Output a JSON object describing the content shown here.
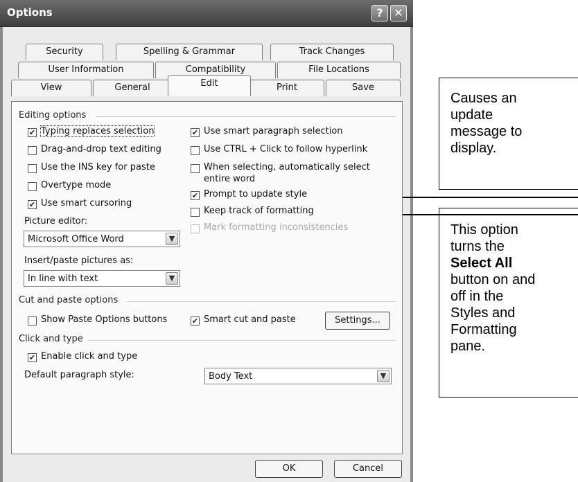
{
  "dialog": {
    "title": "Options",
    "help_symbol": "?",
    "close_symbol": "✕"
  },
  "tabs": {
    "row1": [
      "Security",
      "Spelling & Grammar",
      "Track Changes"
    ],
    "row2": [
      "User Information",
      "Compatibility",
      "File Locations"
    ],
    "row3": [
      "View",
      "General",
      "Edit",
      "Print",
      "Save"
    ],
    "active": "Edit"
  },
  "editing": {
    "section": "Editing options",
    "typing_replaces": "Typing replaces selection",
    "drag_drop": "Drag-and-drop text editing",
    "ins_key": "Use the INS key for paste",
    "overtype": "Overtype mode",
    "smart_cursoring": "Use smart cursoring",
    "picture_editor_label": "Picture editor:",
    "picture_editor_value": "Microsoft Office Word",
    "insert_paste_label": "Insert/paste pictures as:",
    "insert_paste_value": "In line with text",
    "smart_paragraph": "Use smart paragraph selection",
    "ctrl_click_a": "Use CTRL + Click to follow ",
    "ctrl_click_b": "hyperlink",
    "auto_select_line1": "When selecting, automatically select",
    "auto_select_line2": "entire word",
    "prompt_update": "Prompt to update style",
    "keep_track": "Keep track of formatting",
    "mark_inconsistencies": "Mark formatting inconsistencies"
  },
  "cutpaste": {
    "section": "Cut and paste options",
    "show_paste": "Show Paste Options buttons",
    "smart_cut": "Smart cut and paste",
    "settings": "Settings..."
  },
  "clicktype": {
    "section": "Click and type",
    "enable": "Enable click and type",
    "default_style_label": "Default paragraph style:",
    "default_style_value": "Body Text"
  },
  "buttons": {
    "ok": "OK",
    "cancel": "Cancel"
  },
  "checkmark": "✔",
  "callouts": {
    "top": [
      "Causes an",
      "update",
      "message to",
      "display."
    ],
    "bottom_before": [
      "This option",
      "turns the"
    ],
    "bottom_bold": "Select All",
    "bottom_after": [
      "button on and",
      "off in the",
      "Styles and",
      "Formatting",
      "pane."
    ]
  }
}
